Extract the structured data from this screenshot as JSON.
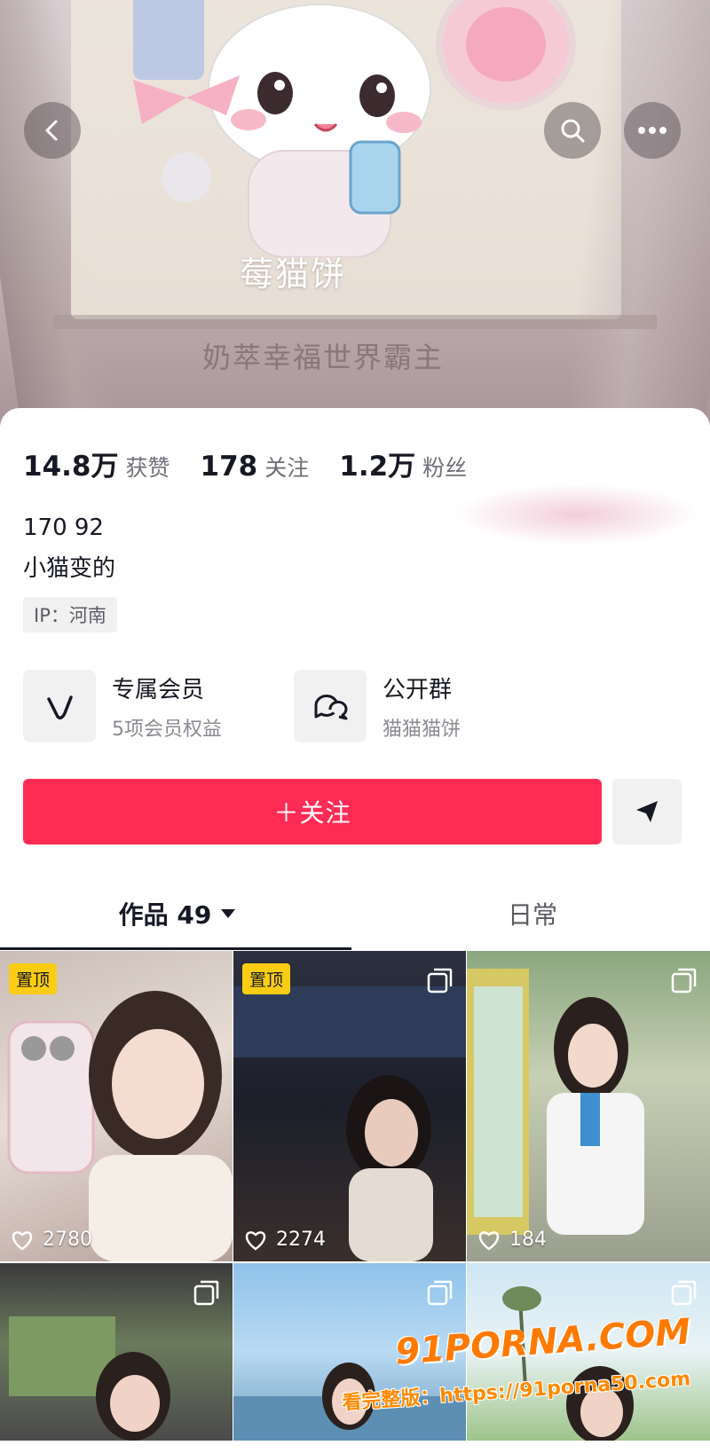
{
  "header": {
    "title": "莓猫饼",
    "subtitle": "奶萃幸福世界霸主",
    "back_icon": "chevron-left-icon",
    "search_icon": "search-icon",
    "more_icon": "more-dots-icon"
  },
  "stats": [
    {
      "value": "14.8万",
      "label": "获赞"
    },
    {
      "value": "178",
      "label": "关注"
    },
    {
      "value": "1.2万",
      "label": "粉丝"
    }
  ],
  "bio": {
    "line1": "170 92",
    "line2": "小猫变的",
    "ip": "IP：河南"
  },
  "features": {
    "vip": {
      "title": "专属会员",
      "subtitle": "5项会员权益",
      "icon": "vip-v-icon"
    },
    "group": {
      "title": "公开群",
      "subtitle": "猫猫猫饼",
      "icon": "group-chat-icon"
    }
  },
  "actions": {
    "follow_label": "＋关注",
    "share_icon": "send-icon"
  },
  "tabs": {
    "works": "作品 49",
    "daily": "日常"
  },
  "videos": [
    {
      "pinned": "置顶",
      "likes": "2780"
    },
    {
      "pinned": "置顶",
      "likes": "2274"
    },
    {
      "pinned": "",
      "likes": "184"
    },
    {
      "pinned": "",
      "likes": ""
    },
    {
      "pinned": "",
      "likes": ""
    },
    {
      "pinned": "",
      "likes": ""
    }
  ],
  "watermark": {
    "brand": "91PORNA.COM",
    "line": "看完整版：https://91porna50.com"
  },
  "colors": {
    "follow": "#fe2c55",
    "pin": "#facd14",
    "text": "#161823"
  }
}
